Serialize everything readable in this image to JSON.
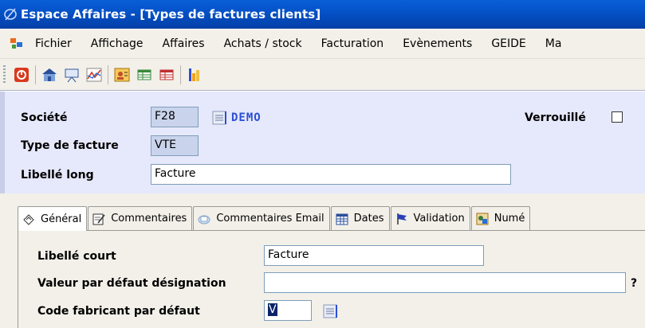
{
  "window": {
    "title": "Espace Affaires - [Types de factures clients]"
  },
  "menubar": {
    "items": [
      "Fichier",
      "Affichage",
      "Affaires",
      "Achats / stock",
      "Facturation",
      "Evènements",
      "GEIDE",
      "Ma"
    ]
  },
  "toolbar": {
    "buttons": [
      "power-icon",
      "home-icon",
      "presentation-icon",
      "chart-icon",
      "user-card-icon",
      "grid-green-icon",
      "grid-red-icon",
      "report-icon"
    ]
  },
  "header": {
    "societe_label": "Société",
    "societe_value": "F28",
    "societe_name": "DEMO",
    "verrouille_label": "Verrouillé",
    "verrouille_checked": false,
    "type_label": "Type de facture",
    "type_value": "VTE",
    "libelle_long_label": "Libellé long",
    "libelle_long_value": "Facture"
  },
  "tabs": [
    {
      "label": "Général",
      "icon": "general-icon",
      "active": true
    },
    {
      "label": "Commentaires",
      "icon": "edit-note-icon",
      "active": false
    },
    {
      "label": "Commentaires Email",
      "icon": "email-icon",
      "active": false
    },
    {
      "label": "Dates",
      "icon": "calendar-icon",
      "active": false
    },
    {
      "label": "Validation",
      "icon": "flag-icon",
      "active": false
    },
    {
      "label": "Numé",
      "icon": "numbering-icon",
      "active": false
    }
  ],
  "general": {
    "libelle_court_label": "Libellé court",
    "libelle_court_value": "Facture",
    "valeur_label": "Valeur par défaut désignation",
    "valeur_value": "",
    "help_mark": "?",
    "code_fab_label": "Code fabricant par défaut",
    "code_fab_value": "V"
  },
  "colors": {
    "title_bar": "#0452c8",
    "header_panel": "#e6e8fb",
    "readonly_field": "#c9d4ec",
    "demo_text": "#2a4fd6"
  }
}
